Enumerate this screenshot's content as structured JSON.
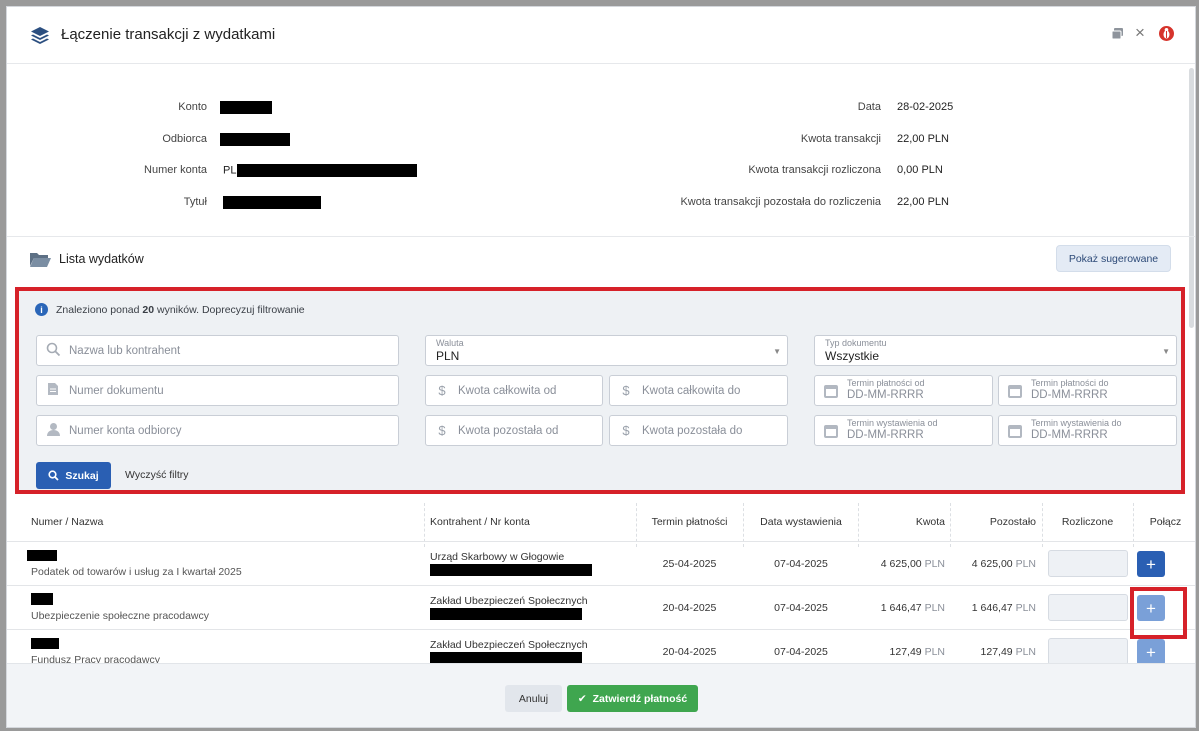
{
  "header": {
    "title": "Łączenie transakcji z wydatkami",
    "icons": [
      "layers-icon",
      "copy-window-icon",
      "close-icon",
      "bug-icon"
    ],
    "close_glyph": "×"
  },
  "info": {
    "left": [
      {
        "label": "Konto",
        "value": ""
      },
      {
        "label": "Odbiorca",
        "value": ""
      },
      {
        "label": "Numer konta",
        "value": "PL"
      },
      {
        "label": "Tytuł",
        "value": ""
      }
    ],
    "right": [
      {
        "label": "Data",
        "value": "28-02-2025"
      },
      {
        "label": "Kwota transakcji",
        "value": "22,00 PLN"
      },
      {
        "label": "Kwota transakcji rozliczona",
        "value": "0,00 PLN"
      },
      {
        "label": "Kwota transakcji pozostała do rozliczenia",
        "value": "22,00 PLN"
      }
    ]
  },
  "list": {
    "title": "Lista wydatków",
    "suggest_button": "Pokaż sugerowane"
  },
  "filters": {
    "alert_prefix": "Znaleziono ponad ",
    "alert_count": "20",
    "alert_suffix": " wyników. Doprecyzuj filtrowanie",
    "name_placeholder": "Nazwa lub kontrahent",
    "doc_number_placeholder": "Numer dokumentu",
    "account_placeholder": "Numer konta odbiorcy",
    "currency_label": "Waluta",
    "currency_value": "PLN",
    "total_from": "Kwota całkowita od",
    "total_to": "Kwota całkowita do",
    "remaining_from": "Kwota pozostała od",
    "remaining_to": "Kwota pozostała do",
    "doc_type_label": "Typ dokumentu",
    "doc_type_value": "Wszystkie",
    "pay_due_from_label": "Termin płatności od",
    "pay_due_to_label": "Termin płatności do",
    "issue_from_label": "Termin wystawienia od",
    "issue_to_label": "Termin wystawienia do",
    "date_placeholder": "DD-MM-RRRR",
    "dollar_glyph": "$",
    "search_button": "Szukaj",
    "clear_button": "Wyczyść filtry"
  },
  "table": {
    "columns": [
      "Numer / Nazwa",
      "Kontrahent / Nr konta",
      "Termin płatności",
      "Data wystawienia",
      "Kwota",
      "Pozostało",
      "Rozliczone",
      "Połącz"
    ],
    "currency": "PLN",
    "plus_glyph": "+",
    "rows": [
      {
        "name": "Podatek od towarów i usług za I kwartał 2025",
        "contractor": "Urząd Skarbowy w Głogowie",
        "due": "25-04-2025",
        "issued": "07-04-2025",
        "amount": "4 625,00",
        "remaining": "4 625,00"
      },
      {
        "name": "Ubezpieczenie społeczne pracodawcy",
        "contractor": "Zakład Ubezpieczeń Społecznych",
        "due": "20-04-2025",
        "issued": "07-04-2025",
        "amount": "1 646,47",
        "remaining": "1 646,47"
      },
      {
        "name": "Fundusz Pracy pracodawcy",
        "contractor": "Zakład Ubezpieczeń Społecznych",
        "due": "20-04-2025",
        "issued": "07-04-2025",
        "amount": "127,49",
        "remaining": "127,49"
      }
    ]
  },
  "footer": {
    "cancel": "Anuluj",
    "confirm": "Zatwierdź płatność"
  },
  "colors": {
    "primary": "#2a5fb3",
    "success": "#3fa64f",
    "highlight": "#d62129",
    "plus_active": "#2a5fb3",
    "plus_disabled": "#7aa0d8"
  }
}
